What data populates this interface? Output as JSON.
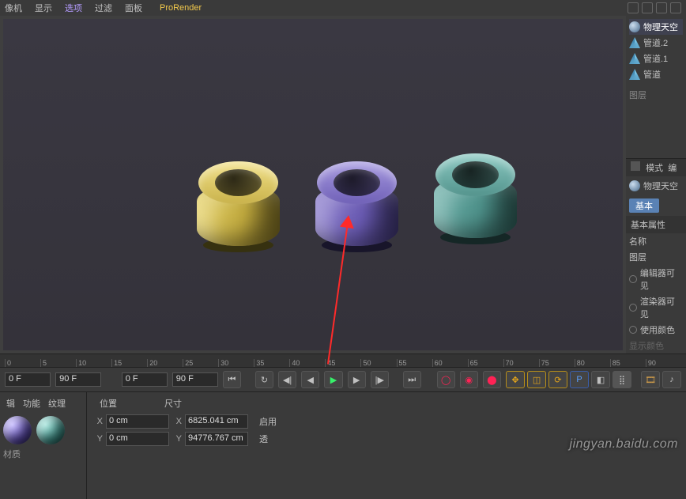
{
  "menubar": {
    "items": [
      "像机",
      "显示",
      "选项",
      "过滤",
      "面板",
      "ProRender"
    ],
    "selected_index": 2
  },
  "objects": [
    {
      "label": "物理天空",
      "sel": true
    },
    {
      "label": "管道.2"
    },
    {
      "label": "管道.1"
    },
    {
      "label": "管道"
    }
  ],
  "layer_label": "图层",
  "timeline": {
    "ticks": [
      "0",
      "5",
      "10",
      "15",
      "20",
      "25",
      "30",
      "35",
      "40",
      "45",
      "50",
      "55",
      "60",
      "65",
      "70",
      "75",
      "80",
      "85",
      "90"
    ],
    "start": "0 F",
    "end": "90 F",
    "cur_a": "0 F",
    "cur_b": "90 F"
  },
  "mat_tabs": [
    "辑",
    "功能",
    "纹理"
  ],
  "mat_label": "材质",
  "coord": {
    "heads": [
      "位置",
      "尺寸"
    ],
    "rows": [
      {
        "axis": "X",
        "pos": "0 cm",
        "size": "6825.041 cm"
      },
      {
        "axis": "Y",
        "pos": "0 cm",
        "size": "94776.767 cm"
      }
    ],
    "extra": [
      "启用",
      "透"
    ]
  },
  "side_attr": {
    "mode": "模式",
    "edit": "编",
    "name_label": "物理天空",
    "basic_tab": "基本",
    "section": "基本属性",
    "name_row": "名称",
    "layer_row": "图层",
    "radios": [
      "编辑器可见",
      "渲染器可见",
      "使用颜色",
      "显示颜色"
    ]
  },
  "watermark": "jingyan.baidu.com"
}
